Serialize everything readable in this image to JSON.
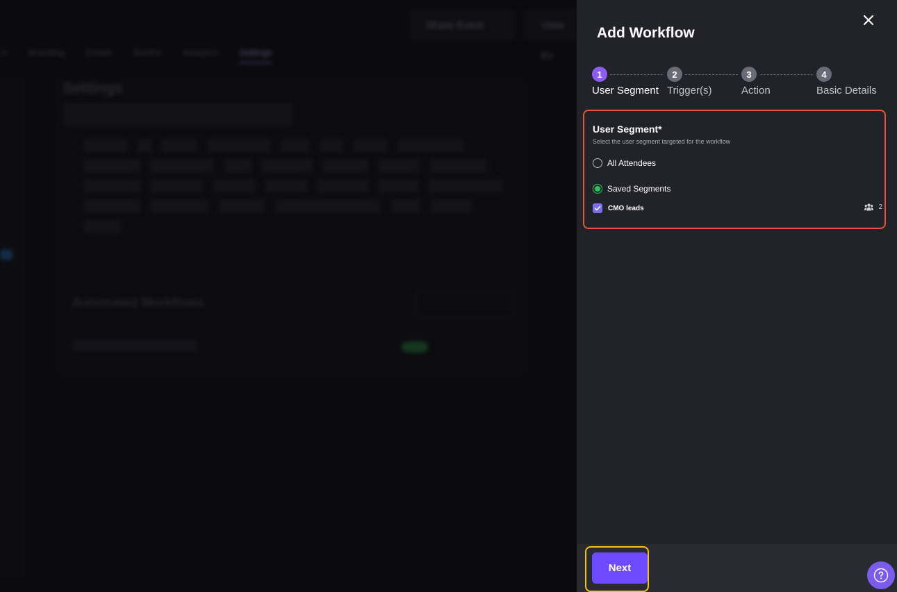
{
  "background": {
    "top_buttons": [
      "Share Event",
      "View Ev"
    ],
    "tabs": [
      {
        "label": "rs",
        "active": false
      },
      {
        "label": "Branding",
        "active": false
      },
      {
        "label": "Emails",
        "active": false
      },
      {
        "label": "Booths",
        "active": false
      },
      {
        "label": "Analytics",
        "active": false
      },
      {
        "label": "Settings",
        "active": true
      }
    ],
    "page_title": "Settings",
    "workflows_title": "Automated Workflows",
    "add_workflow_label": "Add Workflow",
    "workflow_row_name": "Marketing CMO Workflow"
  },
  "drawer": {
    "title": "Add Workflow",
    "close_icon": "close-icon",
    "steps": [
      {
        "number": "1",
        "label": "User Segment",
        "active": true
      },
      {
        "number": "2",
        "label": "Trigger(s)",
        "active": false
      },
      {
        "number": "3",
        "label": "Action",
        "active": false
      },
      {
        "number": "4",
        "label": "Basic Details",
        "active": false
      }
    ],
    "segment": {
      "heading": "User Segment*",
      "subtitle": "Select the user segment targeted for the workflow",
      "options": [
        {
          "label": "All Attendees",
          "checked": false
        },
        {
          "label": "Saved Segments",
          "checked": true
        }
      ],
      "saved_segment": {
        "label": "CMO leads",
        "checked": true,
        "count": "2",
        "icon": "people-icon"
      }
    },
    "footer": {
      "next_label": "Next",
      "help_icon": "help-icon"
    }
  },
  "colors": {
    "accent": "#6d4aff",
    "step_active": "#8b5cf6",
    "radio_checked": "#22c55e",
    "highlight_red": "#e5553f",
    "highlight_yellow": "#f5c518"
  }
}
